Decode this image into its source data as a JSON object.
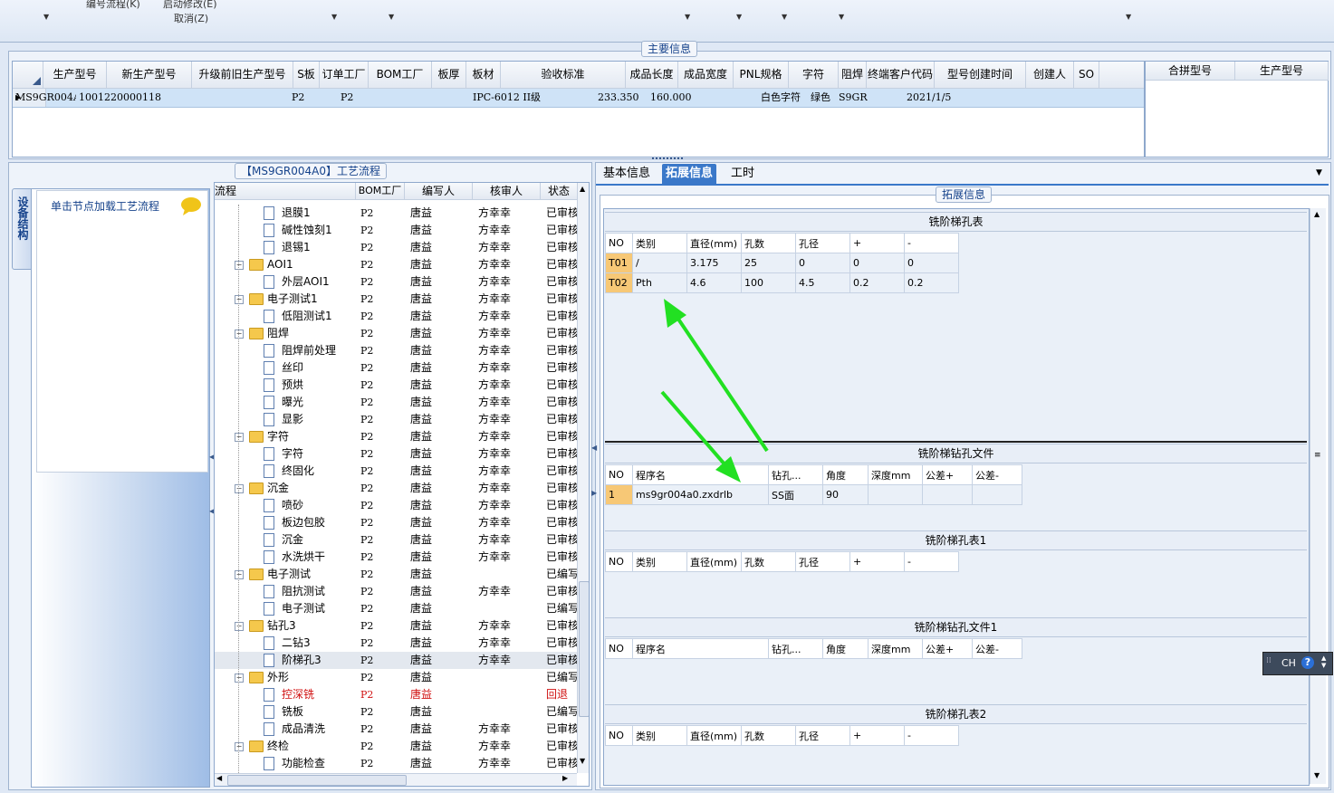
{
  "menu": {
    "item1": "编号流程(K)",
    "item2": "启动修改(E)",
    "item3": "取消(Z)"
  },
  "main_group_title": "主要信息",
  "main_grid": {
    "columns": [
      "生产型号",
      "新生产型号",
      "升级前旧生产型号",
      "S板",
      "订单工厂",
      "BOM工厂",
      "板厚",
      "板材",
      "验收标准",
      "成品长度",
      "成品宽度",
      "PNL规格",
      "字符",
      "阻焊",
      "终端客户代码",
      "型号创建时间",
      "创建人",
      "SO"
    ],
    "row": [
      "MS9GR004A0",
      "10012200001187",
      "",
      "",
      "P2",
      "P2",
      "",
      "",
      "IPC-6012 II级",
      "233.350",
      "160.000",
      "",
      "白色字符",
      "绿色",
      "S9GR",
      "2021/1/5",
      "",
      ""
    ]
  },
  "side_grid": {
    "columns": [
      "合拼型号",
      "生产型号"
    ]
  },
  "left_panel": {
    "tab_label": "设备结构",
    "node_hint": "单击节点加载工艺流程"
  },
  "flow_title": "【MS9GR004A0】工艺流程",
  "flow_columns": [
    "流程",
    "BOM工厂",
    "编写人",
    "核审人",
    "状态"
  ],
  "flow_rows": [
    {
      "type": "file",
      "name": "退膜1",
      "bom": "P2",
      "writer": "唐益",
      "checker": "方幸幸",
      "status": "已审核"
    },
    {
      "type": "file",
      "name": "碱性蚀刻1",
      "bom": "P2",
      "writer": "唐益",
      "checker": "方幸幸",
      "status": "已审核"
    },
    {
      "type": "file",
      "name": "退锡1",
      "bom": "P2",
      "writer": "唐益",
      "checker": "方幸幸",
      "status": "已审核"
    },
    {
      "type": "folder",
      "name": "AOI1",
      "bom": "P2",
      "writer": "唐益",
      "checker": "方幸幸",
      "status": "已审核"
    },
    {
      "type": "file",
      "name": "外层AOI1",
      "bom": "P2",
      "writer": "唐益",
      "checker": "方幸幸",
      "status": "已审核"
    },
    {
      "type": "folder",
      "name": "电子测试1",
      "bom": "P2",
      "writer": "唐益",
      "checker": "方幸幸",
      "status": "已审核"
    },
    {
      "type": "file",
      "name": "低阻测试1",
      "bom": "P2",
      "writer": "唐益",
      "checker": "方幸幸",
      "status": "已审核"
    },
    {
      "type": "folder",
      "name": "阻焊",
      "bom": "P2",
      "writer": "唐益",
      "checker": "方幸幸",
      "status": "已审核"
    },
    {
      "type": "file",
      "name": "阻焊前处理",
      "bom": "P2",
      "writer": "唐益",
      "checker": "方幸幸",
      "status": "已审核"
    },
    {
      "type": "file",
      "name": "丝印",
      "bom": "P2",
      "writer": "唐益",
      "checker": "方幸幸",
      "status": "已审核"
    },
    {
      "type": "file",
      "name": "预烘",
      "bom": "P2",
      "writer": "唐益",
      "checker": "方幸幸",
      "status": "已审核"
    },
    {
      "type": "file",
      "name": "曝光",
      "bom": "P2",
      "writer": "唐益",
      "checker": "方幸幸",
      "status": "已审核"
    },
    {
      "type": "file",
      "name": "显影",
      "bom": "P2",
      "writer": "唐益",
      "checker": "方幸幸",
      "status": "已审核"
    },
    {
      "type": "folder",
      "name": "字符",
      "bom": "P2",
      "writer": "唐益",
      "checker": "方幸幸",
      "status": "已审核"
    },
    {
      "type": "file",
      "name": "字符",
      "bom": "P2",
      "writer": "唐益",
      "checker": "方幸幸",
      "status": "已审核"
    },
    {
      "type": "file",
      "name": "终固化",
      "bom": "P2",
      "writer": "唐益",
      "checker": "方幸幸",
      "status": "已审核"
    },
    {
      "type": "folder",
      "name": "沉金",
      "bom": "P2",
      "writer": "唐益",
      "checker": "方幸幸",
      "status": "已审核"
    },
    {
      "type": "file",
      "name": "喷砂",
      "bom": "P2",
      "writer": "唐益",
      "checker": "方幸幸",
      "status": "已审核"
    },
    {
      "type": "file",
      "name": "板边包胶",
      "bom": "P2",
      "writer": "唐益",
      "checker": "方幸幸",
      "status": "已审核"
    },
    {
      "type": "file",
      "name": "沉金",
      "bom": "P2",
      "writer": "唐益",
      "checker": "方幸幸",
      "status": "已审核"
    },
    {
      "type": "file",
      "name": "水洗烘干",
      "bom": "P2",
      "writer": "唐益",
      "checker": "方幸幸",
      "status": "已审核"
    },
    {
      "type": "folder",
      "name": "电子测试",
      "bom": "P2",
      "writer": "唐益",
      "checker": "",
      "status": "已编写"
    },
    {
      "type": "file",
      "name": "阻抗测试",
      "bom": "P2",
      "writer": "唐益",
      "checker": "方幸幸",
      "status": "已审核"
    },
    {
      "type": "file",
      "name": "电子测试",
      "bom": "P2",
      "writer": "唐益",
      "checker": "",
      "status": "已编写"
    },
    {
      "type": "folder",
      "name": "钻孔3",
      "bom": "P2",
      "writer": "唐益",
      "checker": "方幸幸",
      "status": "已审核"
    },
    {
      "type": "file",
      "name": "二钻3",
      "bom": "P2",
      "writer": "唐益",
      "checker": "方幸幸",
      "status": "已审核"
    },
    {
      "type": "file",
      "name": "阶梯孔3",
      "bom": "P2",
      "writer": "唐益",
      "checker": "方幸幸",
      "status": "已审核"
    },
    {
      "type": "folder",
      "name": "外形",
      "bom": "P2",
      "writer": "唐益",
      "checker": "",
      "status": "已编写"
    },
    {
      "type": "file",
      "name": "控深铣",
      "bom": "P2",
      "writer": "唐益",
      "checker": "",
      "status": "回退",
      "red": true
    },
    {
      "type": "file",
      "name": "铣板",
      "bom": "P2",
      "writer": "唐益",
      "checker": "",
      "status": "已编写"
    },
    {
      "type": "file",
      "name": "成品清洗",
      "bom": "P2",
      "writer": "唐益",
      "checker": "方幸幸",
      "status": "已审核"
    },
    {
      "type": "folder",
      "name": "终检",
      "bom": "P2",
      "writer": "唐益",
      "checker": "方幸幸",
      "status": "已审核"
    },
    {
      "type": "file",
      "name": "功能检查",
      "bom": "P2",
      "writer": "唐益",
      "checker": "方幸幸",
      "status": "已审核"
    }
  ],
  "tabs": [
    "基本信息",
    "拓展信息",
    "工时"
  ],
  "ext_group_title": "拓展信息",
  "tbl1": {
    "title": "铣阶梯孔表",
    "columns": [
      "NO",
      "类别",
      "直径(mm)",
      "孔数",
      "孔径",
      "+",
      "-"
    ],
    "rows": [
      [
        "T01",
        "/",
        "3.175",
        "25",
        "0",
        "0",
        "0"
      ],
      [
        "T02",
        "Pth",
        "4.6",
        "100",
        "4.5",
        "0.2",
        "0.2"
      ]
    ]
  },
  "tbl2": {
    "title": "铣阶梯钻孔文件",
    "columns": [
      "NO",
      "程序名",
      "钻孔...",
      "角度",
      "深度mm",
      "公差+",
      "公差-"
    ],
    "rows": [
      [
        "1",
        "ms9gr004a0.zxdrlb",
        "SS面",
        "90",
        "",
        "",
        ""
      ]
    ]
  },
  "tbl3": {
    "title": "铣阶梯孔表1",
    "columns": [
      "NO",
      "类别",
      "直径(mm)",
      "孔数",
      "孔径",
      "+",
      "-"
    ]
  },
  "tbl4": {
    "title": "铣阶梯钻孔文件1",
    "columns": [
      "NO",
      "程序名",
      "钻孔...",
      "角度",
      "深度mm",
      "公差+",
      "公差-"
    ]
  },
  "tbl5": {
    "title": "铣阶梯孔表2",
    "columns": [
      "NO",
      "类别",
      "直径(mm)",
      "孔数",
      "孔径",
      "+",
      "-"
    ]
  },
  "ime": {
    "label": "CH"
  },
  "colors": {
    "arrow": "#22e022",
    "selected_row": "#cfe3f7",
    "tab_active": "#3a78c9"
  }
}
